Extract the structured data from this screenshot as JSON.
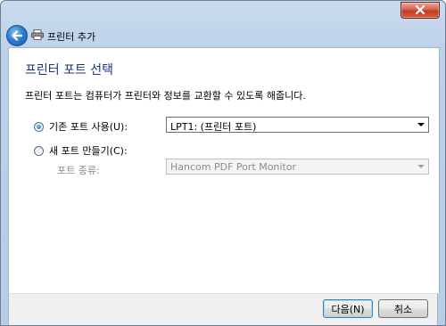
{
  "window": {
    "close_icon": "close-icon"
  },
  "nav": {
    "title": "프린터 추가",
    "back_icon": "back-arrow-icon",
    "printer_icon": "printer-icon"
  },
  "main": {
    "heading": "프린터 포트 선택",
    "description": "프린터 포트는 컴퓨터가 프린터와 정보를 교환할 수 있도록 해줍니다.",
    "use_existing_label": "기존 포트 사용(U):",
    "use_existing_selected": true,
    "existing_port_value": "LPT1: (프린터 포트)",
    "create_new_label": "새 포트 만들기(C):",
    "create_new_selected": false,
    "port_type_label": "포트 종류:",
    "port_type_value": "Hancom PDF Port Monitor"
  },
  "footer": {
    "next_label": "다음(N)",
    "cancel_label": "취소"
  },
  "colors": {
    "heading": "#1e3287",
    "frame": "#bcd1e8",
    "close": "#c63a24"
  }
}
